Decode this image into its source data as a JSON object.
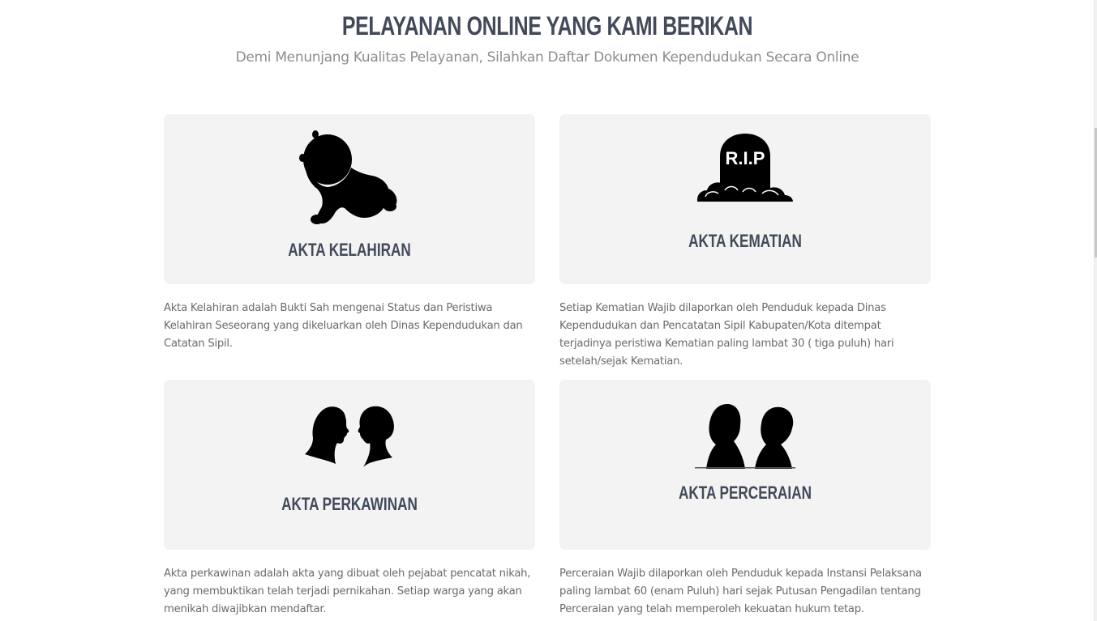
{
  "header": {
    "title": "PELAYANAN ONLINE YANG KAMI BERIKAN",
    "subtitle": "Demi Menunjang Kualitas Pelayanan, Silahkan Daftar Dokumen Kependudukan Secara Online"
  },
  "services": [
    {
      "title": "AKTA KELAHIRAN",
      "icon": "baby-icon",
      "description": "Akta Kelahiran adalah Bukti Sah mengenai Status dan Peristiwa Kelahiran Seseorang yang dikeluarkan oleh Dinas Kependudukan dan Catatan Sipil."
    },
    {
      "title": "AKTA KEMATIAN",
      "icon": "tombstone-icon",
      "icon_text": "R.I.P",
      "description": "Setiap Kematian Wajib dilaporkan oleh Penduduk kepada Dinas Kependudukan dan Pencatatan Sipil Kabupaten/Kota ditempat terjadinya peristiwa Kematian paling lambat 30 ( tiga puluh) hari setelah/sejak Kematian."
    },
    {
      "title": "AKTA PERKAWINAN",
      "icon": "couple-facing-icon",
      "description": "Akta perkawinan adalah akta yang dibuat oleh pejabat pencatat nikah, yang membuktikan telah terjadi pernikahan. Setiap warga yang akan menikah diwajibkan mendaftar."
    },
    {
      "title": "AKTA PERCERAIAN",
      "icon": "couple-apart-icon",
      "description": "Perceraian Wajib dilaporkan oleh Penduduk kepada Instansi Pelaksana paling lambat 60 (enam Puluh) hari sejak Putusan Pengadilan tentang Perceraian yang telah memperoleh kekuatan hukum tetap."
    }
  ],
  "colors": {
    "title": "#424a5a",
    "card_bg": "#f3f3f3",
    "text": "#6b6b6b",
    "icon": "#000000"
  }
}
